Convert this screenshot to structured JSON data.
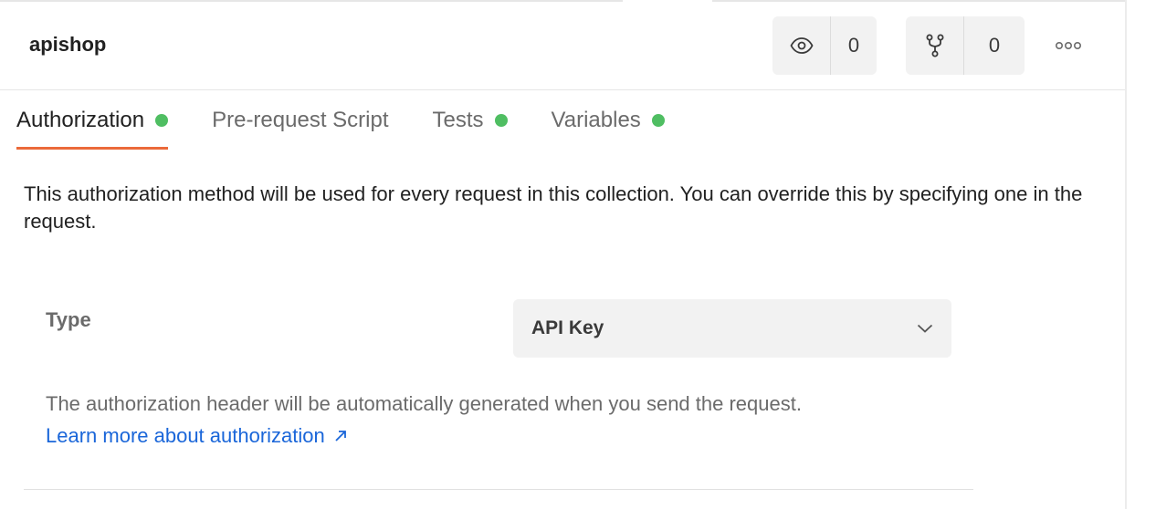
{
  "header": {
    "title": "apishop",
    "watch_count": "0",
    "fork_count": "0"
  },
  "tabs": [
    {
      "label": "Authorization",
      "dot": true,
      "active": true
    },
    {
      "label": "Pre-request Script",
      "dot": false,
      "active": false
    },
    {
      "label": "Tests",
      "dot": true,
      "active": false
    },
    {
      "label": "Variables",
      "dot": true,
      "active": false
    }
  ],
  "auth": {
    "description": "This authorization method will be used for every request in this collection. You can override this by specifying one in the request.",
    "type_label": "Type",
    "type_value": "API Key",
    "help_text": "The authorization header will be automatically generated when you send the request.",
    "learn_more": "Learn more about authorization"
  },
  "colors": {
    "accent": "#eb6a3a",
    "status_dot": "#4fbe62",
    "link": "#1a66d9"
  },
  "icons": {
    "watch": "eye-icon",
    "fork": "fork-icon",
    "more": "more-horizontal-icon",
    "dropdown": "chevron-down-icon",
    "external": "arrow-up-right-icon"
  }
}
